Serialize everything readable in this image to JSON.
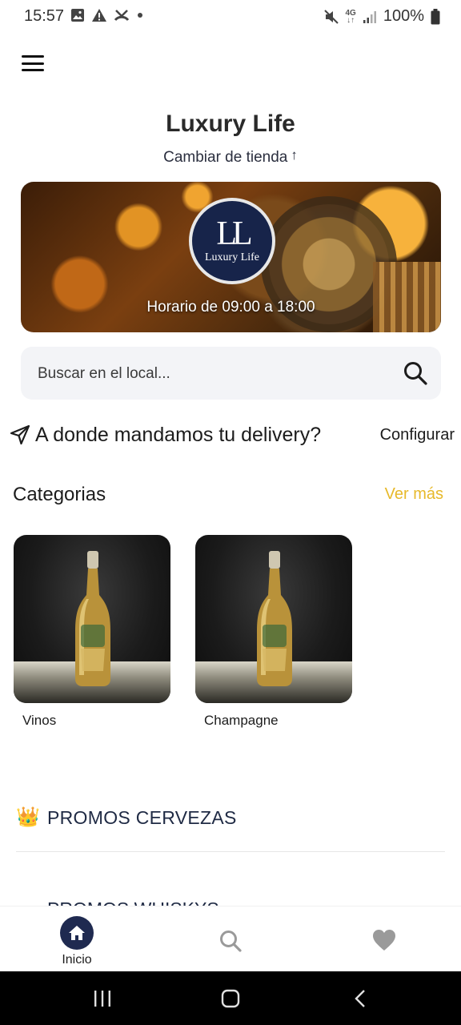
{
  "status_bar": {
    "time": "15:57",
    "net_top": "4G",
    "net_bottom": "↓↑",
    "battery": "100%"
  },
  "header": {
    "store_name": "Luxury Life",
    "change_store": "Cambiar de tienda",
    "change_store_arrow": "↑"
  },
  "banner": {
    "logo_monogram": "LL",
    "logo_name": "Luxury Life",
    "hours": "Horario de 09:00 a 18:00"
  },
  "search": {
    "placeholder": "Buscar en el local..."
  },
  "delivery": {
    "prompt": "A donde mandamos tu delivery?",
    "configure": "Configurar"
  },
  "categories": {
    "title": "Categorias",
    "see_more": "Ver más",
    "items": [
      {
        "label": "Vinos"
      },
      {
        "label": "Champagne"
      }
    ]
  },
  "promos": [
    {
      "icon": "👑",
      "label": "PROMOS CERVEZAS"
    },
    {
      "icon": "👑",
      "label": "PROMOS WHISKYS"
    }
  ],
  "bottom_nav": {
    "home_label": "Inicio"
  },
  "colors": {
    "accent_navy": "#1f2a50",
    "see_more_gold": "#e7b92a",
    "search_bg": "#f3f4f7"
  }
}
